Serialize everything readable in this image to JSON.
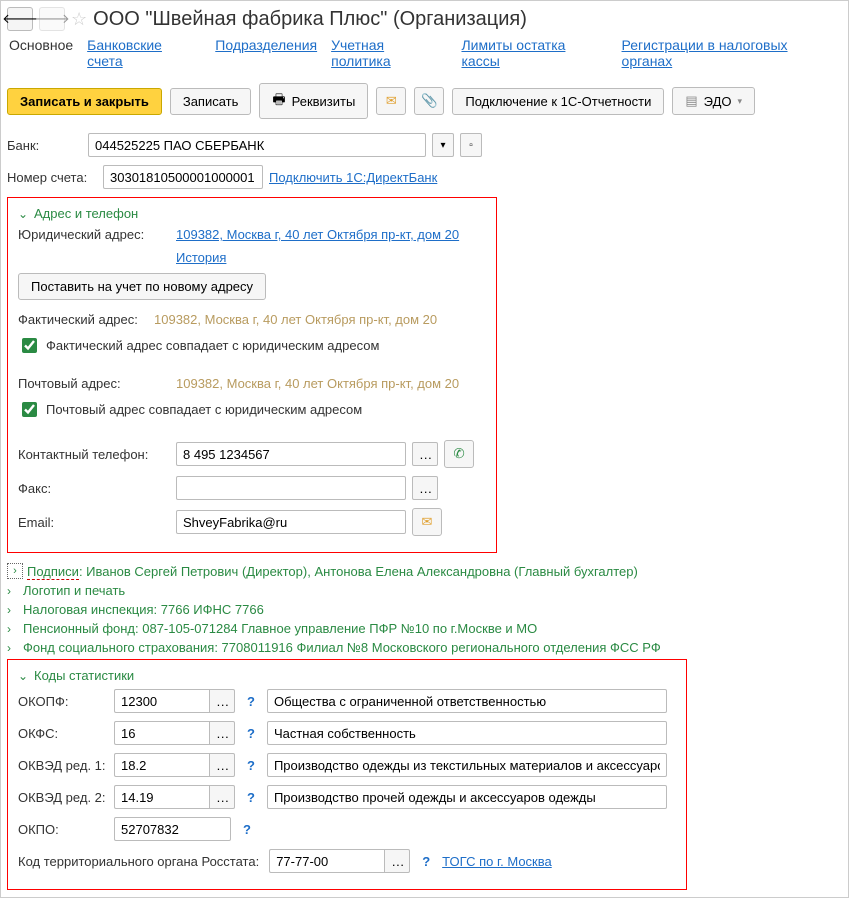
{
  "header": {
    "title": "ООО \"Швейная фабрика Плюс\" (Организация)"
  },
  "tabs": {
    "active": "Основное",
    "items": [
      "Основное",
      "Банковские счета",
      "Подразделения",
      "Учетная политика",
      "Лимиты остатка кассы",
      "Регистрации в налоговых органах"
    ]
  },
  "toolbar": {
    "save_close": "Записать и закрыть",
    "save": "Записать",
    "requisites": "Реквизиты",
    "connect_1c": "Подключение к 1С-Отчетности",
    "edo": "ЭДО"
  },
  "bank": {
    "label": "Банк:",
    "value": "044525225 ПАО СБЕРБАНК"
  },
  "account": {
    "label": "Номер счета:",
    "value": "30301810500001000001",
    "direct_bank_link": "Подключить 1С:ДиректБанк"
  },
  "address_section": {
    "title": "Адрес и телефон",
    "legal_label": "Юридический адрес:",
    "legal_value": "109382, Москва г, 40 лет Октября пр-кт, дом 20",
    "history": "История",
    "register_btn": "Поставить на учет по новому адресу",
    "actual_label": "Фактический адрес:",
    "actual_value": "109382, Москва г, 40 лет Октября пр-кт, дом 20",
    "actual_same": "Фактический адрес совпадает с юридическим адресом",
    "postal_label": "Почтовый адрес:",
    "postal_value": "109382, Москва г, 40 лет Октября пр-кт, дом 20",
    "postal_same": "Почтовый адрес совпадает с юридическим адресом",
    "phone_label": "Контактный телефон:",
    "phone_value": "8 495 1234567",
    "fax_label": "Факс:",
    "fax_value": "",
    "email_label": "Email:",
    "email_value": "ShveyFabrika@ru"
  },
  "expanders": {
    "signatures": "Подписи: Иванов Сергей Петрович (Директор), Антонова Елена Александровна (Главный бухгалтер)",
    "signatures_prefix": "Подписи",
    "logo": "Логотип и печать",
    "tax": "Налоговая инспекция: 7766 ИФНС 7766",
    "pension": "Пенсионный фонд: 087-105-071284 Главное управление ПФР №10 по г.Москве и МО",
    "fss": "Фонд социального страхования: 7708011916 Филиал №8 Московского регионального отделения ФСС РФ"
  },
  "stats": {
    "title": "Коды статистики",
    "okopf_label": "ОКОПФ:",
    "okopf_code": "12300",
    "okopf_desc": "Общества с ограниченной ответственностью",
    "okfs_label": "ОКФС:",
    "okfs_code": "16",
    "okfs_desc": "Частная собственность",
    "okved1_label": "ОКВЭД ред. 1:",
    "okved1_code": "18.2",
    "okved1_desc": "Производство одежды из текстильных материалов и аксессуаров о",
    "okved2_label": "ОКВЭД ред. 2:",
    "okved2_code": "14.19",
    "okved2_desc": "Производство прочей одежды и аксессуаров одежды",
    "okpo_label": "ОКПО:",
    "okpo_code": "52707832",
    "rosstat_label": "Код территориального органа Росстата:",
    "rosstat_code": "77-77-00",
    "rosstat_link": "ТОГС по г. Москва"
  },
  "qmark": "?"
}
